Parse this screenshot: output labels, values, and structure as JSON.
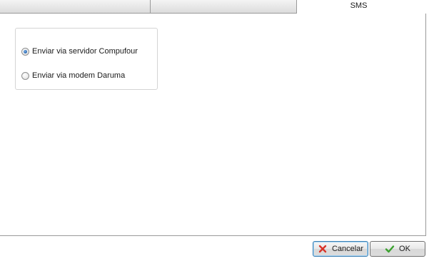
{
  "tabs": {
    "active_label": "SMS"
  },
  "sms_options": {
    "items": [
      {
        "label": "Enviar via servidor Compufour",
        "checked": true
      },
      {
        "label": "Enviar via modem Daruma",
        "checked": false
      }
    ]
  },
  "footer": {
    "cancel_label": "Cancelar",
    "ok_label": "OK",
    "cancel_icon": "close-x-icon",
    "ok_icon": "checkmark-icon",
    "cancel_icon_color": "#d8342a",
    "ok_icon_color": "#3aa12e"
  }
}
